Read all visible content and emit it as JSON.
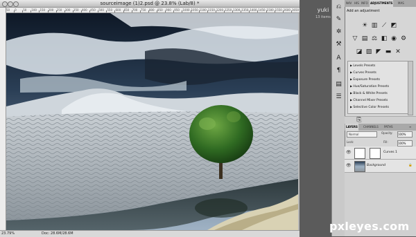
{
  "document": {
    "title": "sourceimage (1)2.psd @ 23.8% (Lab/8) *",
    "ruler_ticks": [
      "50",
      "0",
      "50",
      "100",
      "150",
      "200",
      "250",
      "300",
      "350",
      "400",
      "450",
      "500",
      "550",
      "600",
      "650",
      "700",
      "750",
      "800",
      "850",
      "900",
      "950",
      "1000",
      "1050",
      "1100",
      "1150",
      "1200",
      "1250",
      "1300",
      "1350",
      "1400",
      "1450",
      "1500",
      "1550",
      "1600",
      "1650"
    ],
    "zoom": "23.79%",
    "doc_size": "Doc: 28.6M/28.6M"
  },
  "user": {
    "name": "yuki",
    "items": "13 items"
  },
  "adjustments_panel": {
    "tabs": [
      "NAV",
      "HIS",
      "INFO",
      "ADJUSTMENTS",
      "MAS"
    ],
    "active_tab": "ADJUSTMENTS",
    "title": "Add an adjustment",
    "presets": [
      "Levels Presets",
      "Curves Presets",
      "Exposure Presets",
      "Hue/Saturation Presets",
      "Black & White Presets",
      "Channel Mixer Presets",
      "Selective Color Presets"
    ]
  },
  "layers_panel": {
    "tabs": [
      "LAYERS",
      "CHANNELS",
      "PATHS"
    ],
    "active_tab": "LAYERS",
    "blend_mode": "Normal",
    "opacity_label": "Opacity:",
    "opacity_value": "100%",
    "lock_label": "Lock:",
    "fill_label": "Fill:",
    "fill_value": "100%",
    "layers": [
      {
        "name": "Curves 1",
        "type": "adjustment"
      },
      {
        "name": "Background",
        "type": "image"
      }
    ]
  },
  "watermark": {
    "text": "pxleyes",
    "suffix": ".com"
  },
  "colors": {
    "accent": "#2d5ea8",
    "panel_bg": "#d6d6d6",
    "canvas_sky": "#1c2c3f",
    "tree_green": "#2f6a22"
  }
}
